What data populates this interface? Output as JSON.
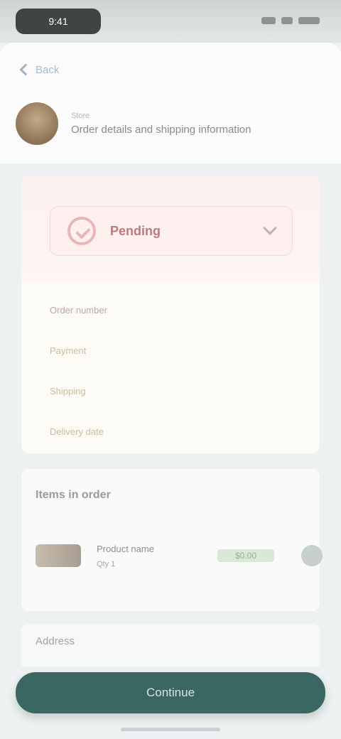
{
  "status_bar": {
    "time": "9:41"
  },
  "header": {
    "back_label": "Back",
    "profile_sub": "Store",
    "profile_title": "Order details and shipping information"
  },
  "order": {
    "status_label": "Pending",
    "details": [
      "Order number",
      "Payment",
      "Shipping",
      "Delivery date"
    ]
  },
  "products": {
    "section_title": "Items in order",
    "items": [
      {
        "name": "Product name",
        "meta": "Qty 1",
        "price": "$0.00"
      }
    ]
  },
  "lower": {
    "title": "Address"
  },
  "action": {
    "label": "Continue"
  },
  "colors": {
    "accent": "#3b6762",
    "status": "#bd7a7a",
    "background": "#eef1f1"
  },
  "icons": [
    "back-icon",
    "avatar",
    "check-circle-icon",
    "chevron-down-icon"
  ]
}
